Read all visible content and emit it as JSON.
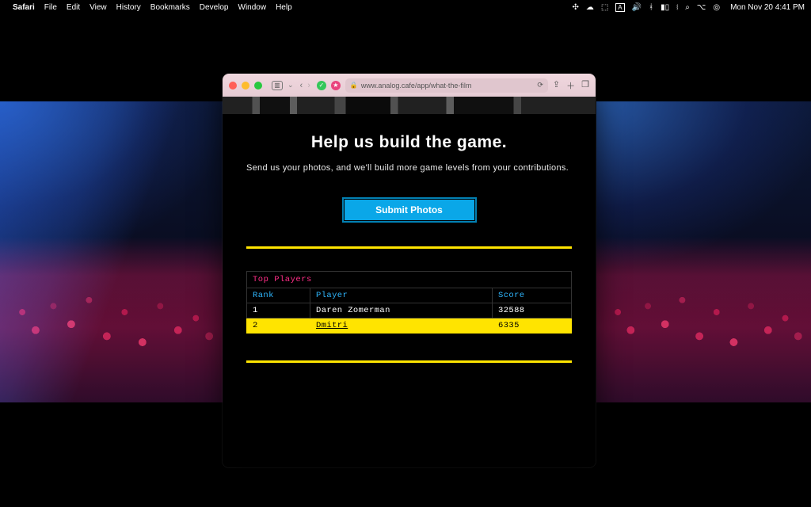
{
  "menubar": {
    "apple_glyph": "",
    "app": "Safari",
    "items": [
      "File",
      "Edit",
      "View",
      "History",
      "Bookmarks",
      "Develop",
      "Window",
      "Help"
    ],
    "status_icons": [
      "compass-icon",
      "cloud-icon",
      "dropbox-icon",
      "input-a-icon",
      "volume-icon",
      "bluetooth-icon",
      "battery-icon",
      "wifi-icon",
      "search-icon",
      "control-center-icon",
      "siri-icon"
    ],
    "clock": "Mon Nov 20  4:41 PM"
  },
  "safari": {
    "url_display": "www.analog.cafe/app/what-the-film",
    "sidebar_glyph": "▥",
    "dropdown_glyph": "⌄",
    "back_glyph": "‹",
    "fwd_glyph": "›",
    "reload_glyph": "⟳",
    "share_glyph": "⇪",
    "newtab_glyph": "＋",
    "tabs_glyph": "❐",
    "lock_glyph": "🔒"
  },
  "page": {
    "title": "Help us build the game.",
    "subtitle": "Send us your photos, and we'll build more game levels from your contributions.",
    "cta_label": "Submit Photos",
    "board": {
      "caption": "Top Players",
      "cols": {
        "rank": "Rank",
        "player": "Player",
        "score": "Score"
      },
      "rows": [
        {
          "rank": "1",
          "player": "Daren Zomerman",
          "score": "32588",
          "hl": false,
          "link": false
        },
        {
          "rank": "2",
          "player": "Dmitri",
          "score": "6335",
          "hl": true,
          "link": true
        }
      ]
    }
  },
  "colors": {
    "accent_yellow": "#ffe400",
    "accent_blue": "#0aa7e8",
    "accent_pink": "#ff2d87",
    "header_blue": "#2fb7ff"
  }
}
